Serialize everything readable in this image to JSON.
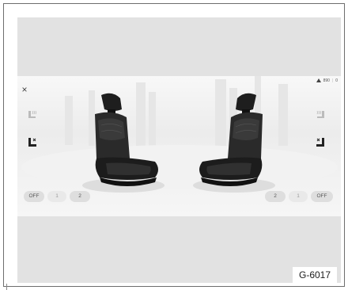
{
  "status": {
    "left": "890",
    "right": "0"
  },
  "controls": {
    "close_label": "×",
    "left_levels": [
      "OFF",
      "1",
      "2"
    ],
    "right_levels": [
      "2",
      "1",
      "OFF"
    ]
  },
  "figure_code": "G-6017",
  "icons": {
    "close": "close-icon",
    "left_heat": "seat-heating-icon",
    "left_vent": "seat-ventilation-icon",
    "right_heat": "seat-heating-icon",
    "right_vent": "seat-ventilation-icon",
    "status": "signal-icon"
  },
  "colors": {
    "active_pill_text": "#555555",
    "inactive_pill_text": "#9a9a9a"
  }
}
